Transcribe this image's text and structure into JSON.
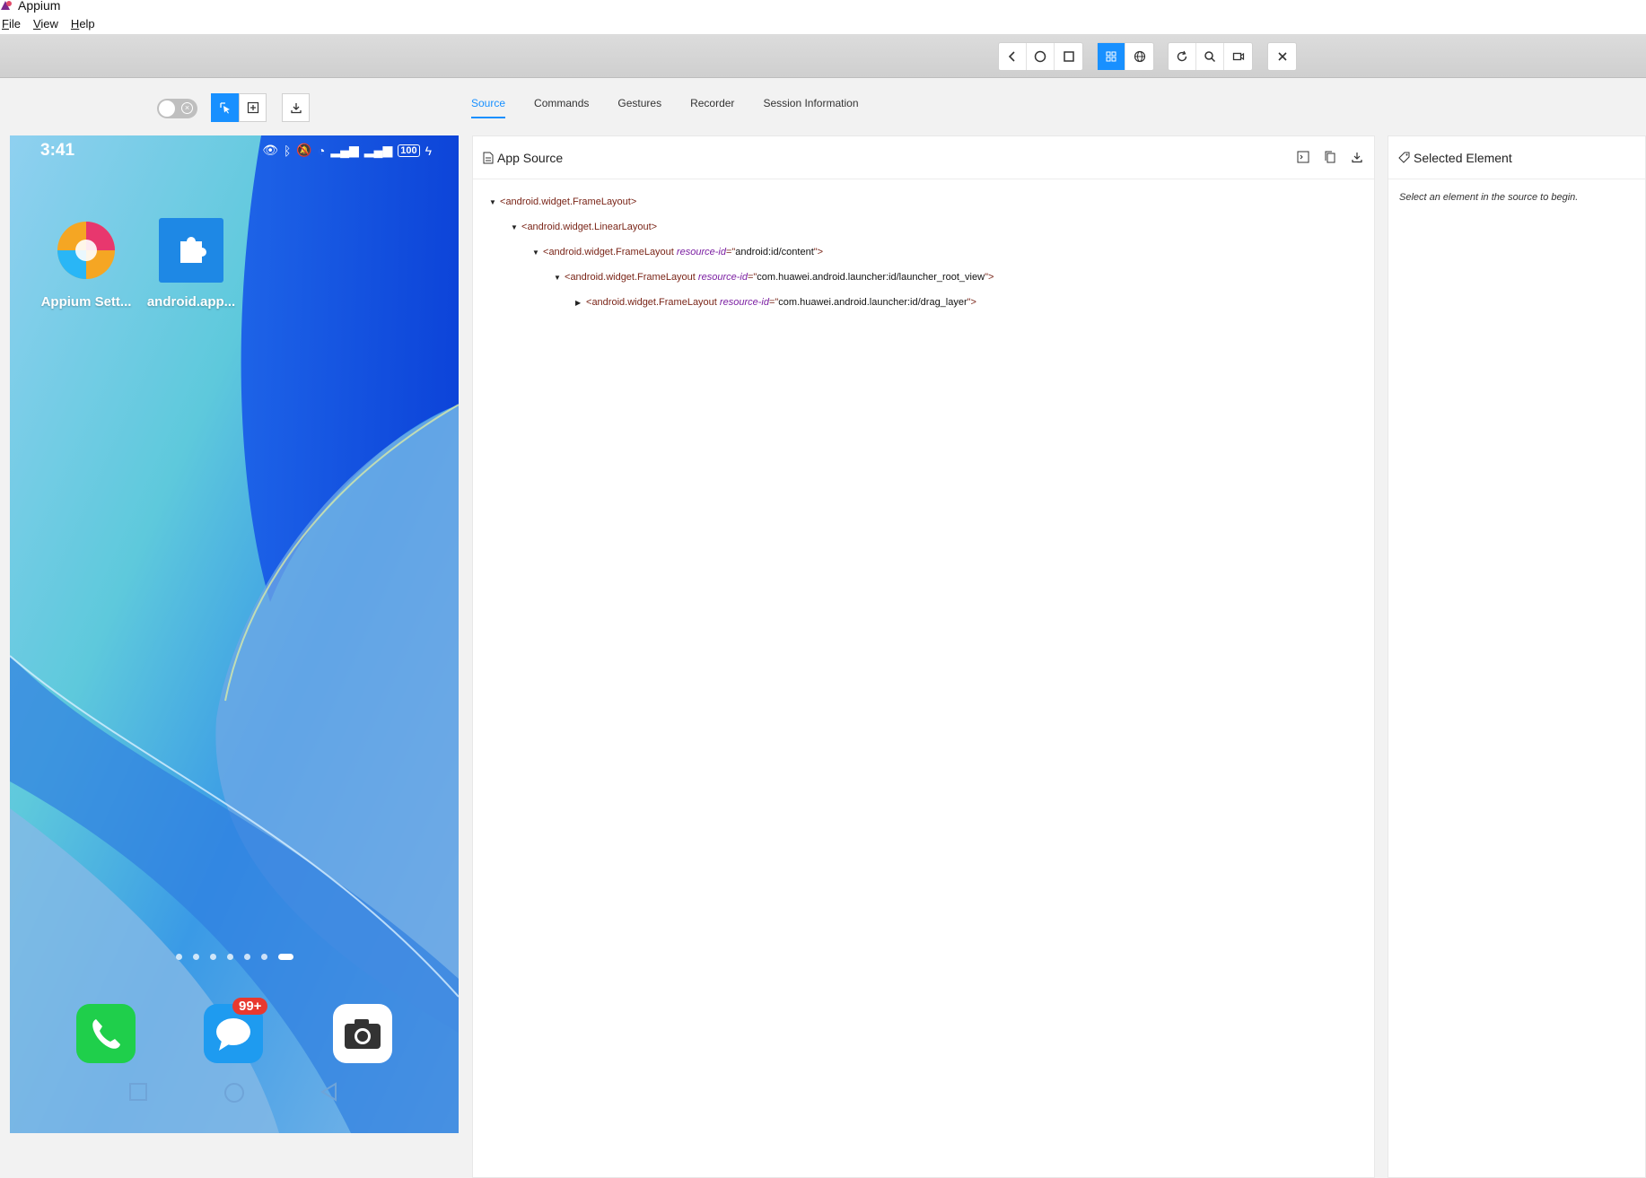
{
  "window": {
    "title": "Appium",
    "menu": [
      "File",
      "View",
      "Help"
    ]
  },
  "topbar": {
    "buttons": [
      "back-icon",
      "home-icon",
      "app-switch-icon",
      "native-mode-icon",
      "web-mode-icon",
      "refresh-icon",
      "search-icon",
      "record-icon",
      "close-icon"
    ],
    "active": "native-mode-icon"
  },
  "toolbar": {
    "toggle_state": "off",
    "buttons": [
      "select-element-icon",
      "tap-coordinates-icon",
      "download-screenshot-icon"
    ]
  },
  "tabs": [
    {
      "label": "Source",
      "active": true
    },
    {
      "label": "Commands",
      "active": false
    },
    {
      "label": "Gestures",
      "active": false
    },
    {
      "label": "Recorder",
      "active": false
    },
    {
      "label": "Session Information",
      "active": false
    }
  ],
  "device": {
    "status_time": "3:41",
    "battery": "100",
    "apps": [
      {
        "label": "Appium Sett..."
      },
      {
        "label": "android.app..."
      }
    ],
    "dock_badge": "99+",
    "page_dots": 7,
    "active_dot": 7
  },
  "app_source": {
    "title": "App Source",
    "nodes": [
      {
        "expanded": true,
        "tag": "android.widget.FrameLayout",
        "attr": "",
        "value": ""
      },
      {
        "expanded": true,
        "tag": "android.widget.LinearLayout",
        "attr": "",
        "value": ""
      },
      {
        "expanded": true,
        "tag": "android.widget.FrameLayout",
        "attr": "resource-id",
        "value": "android:id/content"
      },
      {
        "expanded": true,
        "tag": "android.widget.FrameLayout",
        "attr": "resource-id",
        "value": "com.huawei.android.launcher:id/launcher_root_view"
      },
      {
        "expanded": false,
        "tag": "android.widget.FrameLayout",
        "attr": "resource-id",
        "value": "com.huawei.android.launcher:id/drag_layer"
      }
    ]
  },
  "selected_element": {
    "title": "Selected Element",
    "hint": "Select an element in the source to begin."
  },
  "colors": {
    "accent": "#1890ff",
    "tag": "#7a2518",
    "attr": "#7b1fa2"
  }
}
